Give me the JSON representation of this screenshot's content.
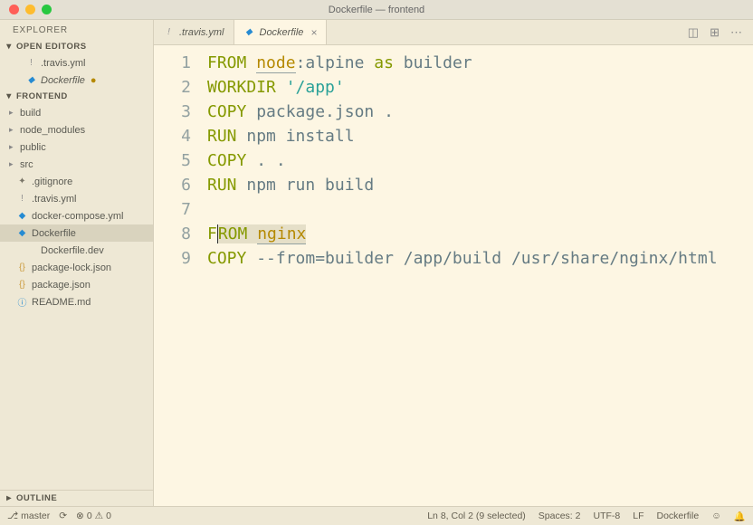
{
  "window_title": "Dockerfile — frontend",
  "sidebar": {
    "explorer_label": "EXPLORER",
    "open_editors_label": "OPEN EDITORS",
    "open_editors": [
      {
        "name": ".travis.yml",
        "icon": "!",
        "icon_class": "ic-yaml"
      },
      {
        "name": "Dockerfile",
        "icon": "◆",
        "icon_class": "ic-docker",
        "dirty": true
      }
    ],
    "project_label": "FRONTEND",
    "tree": [
      {
        "name": "build",
        "type": "folder"
      },
      {
        "name": "node_modules",
        "type": "folder"
      },
      {
        "name": "public",
        "type": "folder"
      },
      {
        "name": "src",
        "type": "folder"
      },
      {
        "name": ".gitignore",
        "type": "file",
        "icon": "✦",
        "icon_class": "ic-git"
      },
      {
        "name": ".travis.yml",
        "type": "file",
        "icon": "!",
        "icon_class": "ic-yaml"
      },
      {
        "name": "docker-compose.yml",
        "type": "file",
        "icon": "◆",
        "icon_class": "ic-docker"
      },
      {
        "name": "Dockerfile",
        "type": "file",
        "icon": "◆",
        "icon_class": "ic-docker",
        "selected": true
      },
      {
        "name": "Dockerfile.dev",
        "type": "file",
        "icon": "",
        "icon_class": "",
        "indent": true
      },
      {
        "name": "package-lock.json",
        "type": "file",
        "icon": "{}",
        "icon_class": "ic-json"
      },
      {
        "name": "package.json",
        "type": "file",
        "icon": "{}",
        "icon_class": "ic-json"
      },
      {
        "name": "README.md",
        "type": "file",
        "icon": "ⓘ",
        "icon_class": "ic-info"
      }
    ],
    "outline_label": "OUTLINE"
  },
  "tabs": [
    {
      "label": ".travis.yml",
      "icon": "!",
      "icon_class": "ic-yaml",
      "active": false
    },
    {
      "label": "Dockerfile",
      "icon": "◆",
      "icon_class": "ic-docker",
      "active": true,
      "dirty": true
    }
  ],
  "code_lines": {
    "l1_from": "FROM",
    "l1_node": "node",
    "l1_rest1": ":alpine ",
    "l1_as": "as",
    "l1_rest2": " builder",
    "l2_workdir": "WORKDIR",
    "l2_str": "'/app'",
    "l3_copy": "COPY",
    "l3_rest": " package.json .",
    "l4_run": "RUN",
    "l4_rest": " npm install",
    "l5_copy": "COPY",
    "l5_rest": " . .",
    "l6_run": "RUN",
    "l6_rest": " npm run build",
    "l8_f": "F",
    "l8_rom": "ROM",
    "l8_nginx": "nginx",
    "l9_copy": "COPY",
    "l9_rest": " --from=builder /app/build /usr/share/nginx/html"
  },
  "line_numbers": [
    "1",
    "2",
    "3",
    "4",
    "5",
    "6",
    "7",
    "8",
    "9"
  ],
  "status": {
    "branch": "master",
    "sync": "⟳",
    "errors": "0",
    "warnings": "0",
    "cursor": "Ln 8, Col 2 (9 selected)",
    "spaces": "Spaces: 2",
    "encoding": "UTF-8",
    "eol": "LF",
    "lang": "Dockerfile",
    "feedback": "☺",
    "bell": "🔔"
  }
}
